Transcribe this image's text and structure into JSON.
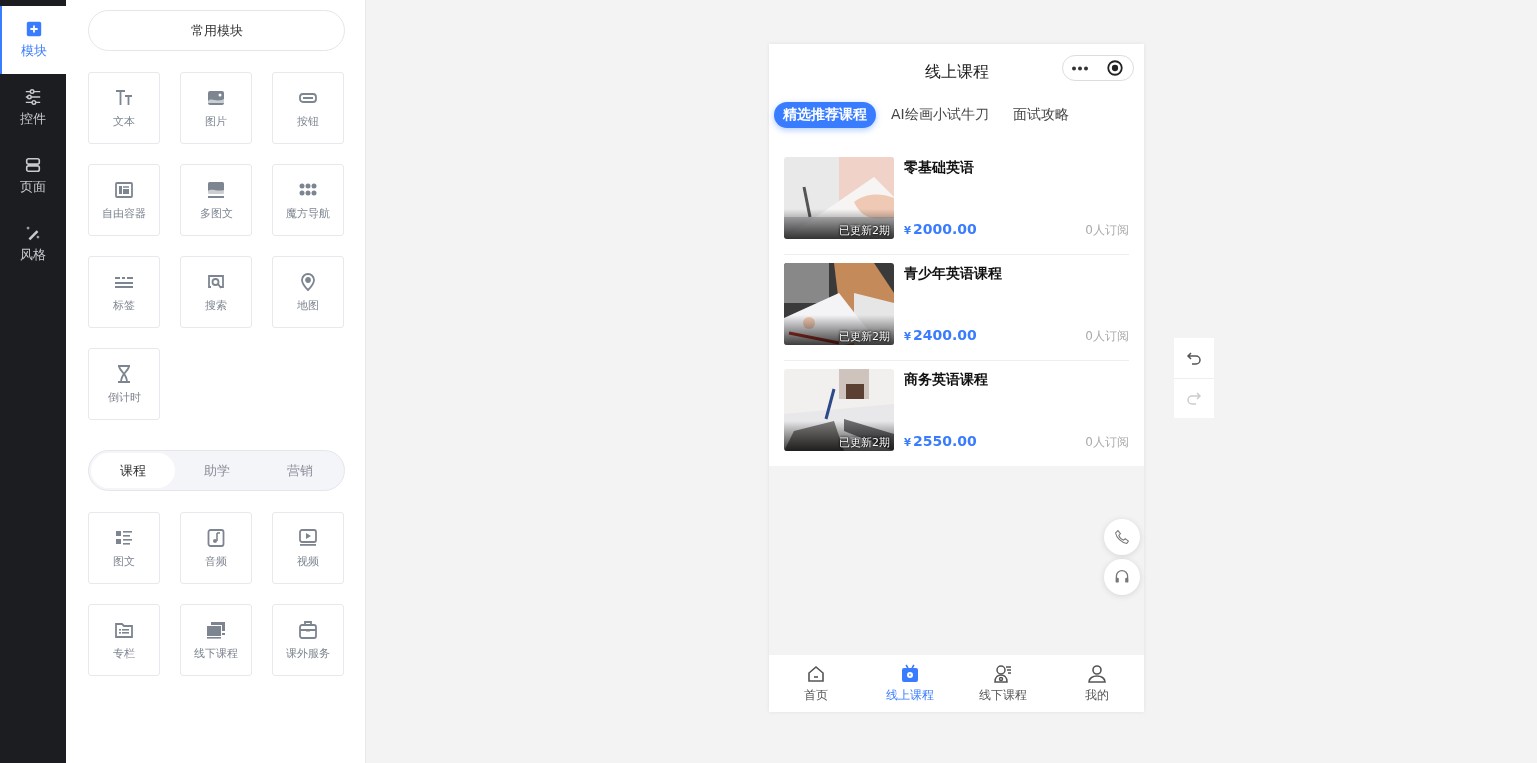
{
  "nav": [
    {
      "label": "模块",
      "selected": true
    },
    {
      "label": "控件",
      "selected": false
    },
    {
      "label": "页面",
      "selected": false
    },
    {
      "label": "风格",
      "selected": false
    }
  ],
  "panel": {
    "common_button": "常用模块",
    "common_modules": [
      "文本",
      "图片",
      "按钮",
      "自由容器",
      "多图文",
      "魔方导航",
      "标签",
      "搜索",
      "地图",
      "倒计时"
    ],
    "segments": [
      {
        "label": "课程",
        "selected": true
      },
      {
        "label": "助学",
        "selected": false
      },
      {
        "label": "营销",
        "selected": false
      }
    ],
    "course_modules": [
      "图文",
      "音频",
      "视频",
      "专栏",
      "线下课程",
      "课外服务"
    ]
  },
  "phone": {
    "title": "线上课程",
    "tabs": [
      {
        "label": "精选推荐课程",
        "selected": true
      },
      {
        "label": "AI绘画小试牛刀",
        "selected": false
      },
      {
        "label": "面试攻略",
        "selected": false
      }
    ],
    "courses": [
      {
        "title": "零基础英语",
        "badge": "已更新2期",
        "currency": "¥",
        "price": "2000.00",
        "subscribers": "0人订阅"
      },
      {
        "title": "青少年英语课程",
        "badge": "已更新2期",
        "currency": "¥",
        "price": "2400.00",
        "subscribers": "0人订阅"
      },
      {
        "title": "商务英语课程",
        "badge": "已更新2期",
        "currency": "¥",
        "price": "2550.00",
        "subscribers": "0人订阅"
      }
    ],
    "tabbar": [
      {
        "label": "首页",
        "selected": false
      },
      {
        "label": "线上课程",
        "selected": true
      },
      {
        "label": "线下课程",
        "selected": false
      },
      {
        "label": "我的",
        "selected": false
      }
    ]
  }
}
